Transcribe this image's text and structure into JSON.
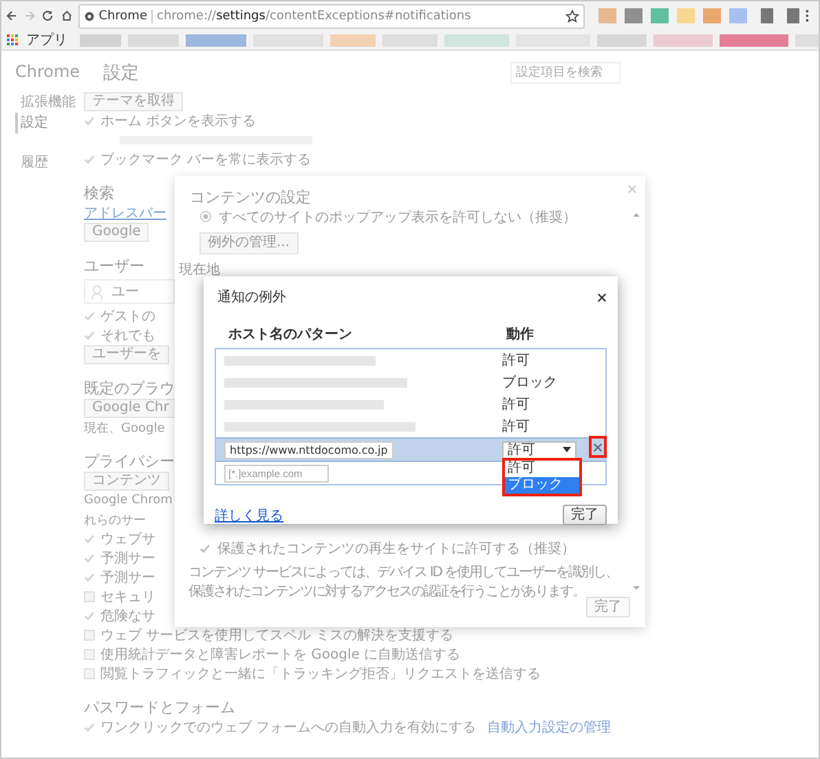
{
  "browser": {
    "site_chip": "Chrome",
    "url": "chrome://**settings**/contentExceptions#notifications",
    "forward_disabled": true,
    "apps_label": "アプリ"
  },
  "settings_page": {
    "nav_title": "Chrome",
    "nav_items": [
      {
        "label": "拡張機能",
        "selected": false
      },
      {
        "label": "設定",
        "selected": true
      },
      {
        "label": "履歴",
        "selected": false
      }
    ],
    "title": "設定",
    "search_placeholder": "設定項目を検索",
    "rows": [
      {
        "kind": "button",
        "label": "テーマを取得"
      },
      {
        "kind": "check",
        "label": "ホーム ボタンを表示する",
        "checked": true
      },
      {
        "kind": "blur"
      },
      {
        "kind": "check",
        "label": "ブックマーク バーを常に表示する",
        "checked": true
      },
      {
        "kind": "heading",
        "label": "検索"
      },
      {
        "kind": "link",
        "label": "アドレスバー"
      },
      {
        "kind": "button",
        "label": "Google"
      },
      {
        "kind": "heading",
        "label": "ユーザー"
      },
      {
        "kind": "user",
        "label": "ユー"
      },
      {
        "kind": "check",
        "label": "ゲストの",
        "checked": true
      },
      {
        "kind": "check",
        "label": "それでも",
        "checked": true
      },
      {
        "kind": "button",
        "label": "ユーザーを"
      },
      {
        "kind": "heading",
        "label": "既定のブラウ"
      },
      {
        "kind": "button",
        "label": "Google Chr"
      },
      {
        "kind": "text",
        "label": "現在、Google"
      },
      {
        "kind": "heading",
        "label": "プライバシー"
      },
      {
        "kind": "button",
        "label": "コンテンツ"
      },
      {
        "kind": "text",
        "label": "Google Chrom"
      },
      {
        "kind": "text",
        "label": "れらのサー"
      },
      {
        "kind": "check",
        "label": "ウェブサ",
        "checked": true
      },
      {
        "kind": "check",
        "label": "予測サー",
        "checked": true
      },
      {
        "kind": "check",
        "label": "予測サー",
        "checked": true
      },
      {
        "kind": "check",
        "label": "セキュリ",
        "checked": false
      },
      {
        "kind": "check",
        "label": "危険なサ",
        "checked": true
      },
      {
        "kind": "check",
        "label": "ウェブ サービスを使用してスペル ミスの解決を支援する",
        "checked": false
      },
      {
        "kind": "check",
        "label": "使用統計データと障害レポートを Google に自動送信する",
        "checked": false
      },
      {
        "kind": "check",
        "label": "閲覧トラフィックと一緒に「トラッキング拒否」リクエストを送信する",
        "checked": false
      },
      {
        "kind": "heading",
        "label": "パスワードとフォーム"
      },
      {
        "kind": "check",
        "label": "ワンクリックでのウェブ フォームへの自動入力を有効にする",
        "checked": true,
        "link": "自動入力設定の管理"
      }
    ]
  },
  "content_settings_dialog": {
    "title": "コンテンツの設定",
    "popup_option": {
      "label": "すべてのサイトのポップアップ表示を許可しない（推奨）",
      "selected": true
    },
    "manage_button": "例外の管理...",
    "location_heading": "現在地",
    "protected_option": {
      "label": "保護されたコンテンツの再生をサイトに許可する（推奨）",
      "checked": true
    },
    "protected_note": "コンテンツ サービスによっては、デバイス ID を使用してユーザーを識別し、保護されたコンテンツに対するアクセスの認証を行うことがあります。",
    "done_button": "完了"
  },
  "exceptions_dialog": {
    "title": "通知の例外",
    "columns": [
      "ホスト名のパターン",
      "動作"
    ],
    "rows": [
      {
        "action": "許可",
        "selected": false
      },
      {
        "action": "ブロック",
        "selected": false
      },
      {
        "action": "許可",
        "selected": false
      },
      {
        "action": "許可",
        "selected": false
      },
      {
        "pattern": "https://www.nttdocomo.co.jp",
        "action": "許可",
        "selected": true,
        "delete_highlighted": true,
        "dropdown": {
          "open": true,
          "highlighted": true,
          "options": [
            {
              "label": "許可",
              "selected": false
            },
            {
              "label": "ブロック",
              "selected": true
            }
          ]
        }
      }
    ],
    "new_pattern": {
      "placeholder": "[*.]example.com"
    },
    "learn_more": "詳しく見る",
    "done_button": "完了"
  }
}
